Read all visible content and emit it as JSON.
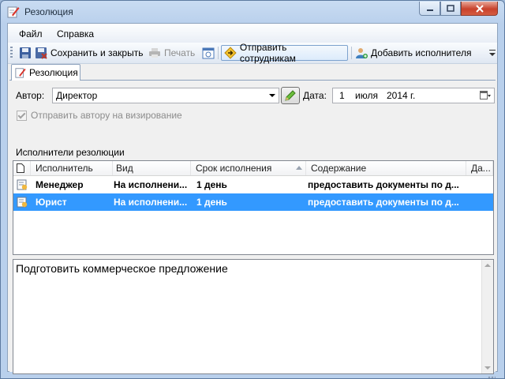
{
  "window": {
    "title": "Резолюция"
  },
  "menu": {
    "items": [
      "Файл",
      "Справка"
    ]
  },
  "toolbar": {
    "save_close": "Сохранить и закрыть",
    "print": "Печать",
    "send_staff": "Отправить сотрудникам",
    "add_executor": "Добавить исполнителя"
  },
  "tab": {
    "label": "Резолюция"
  },
  "form": {
    "author_label": "Автор:",
    "author_value": "Директор",
    "date_label": "Дата:",
    "date_day": "1",
    "date_month": "июля",
    "date_year": "2014 г.",
    "send_author_check": "Отправить автору на визирование",
    "executors_caption": "Исполнители резолюции"
  },
  "grid": {
    "columns": [
      "Исполнитель",
      "Вид",
      "Срок исполнения",
      "Содержание",
      "Да..."
    ],
    "rows": [
      {
        "executor": "Менеджер",
        "kind": "На исполнени...",
        "term": "1 день",
        "content": "предоставить документы по д...",
        "selected": false
      },
      {
        "executor": "Юрист",
        "kind": "На исполнени...",
        "term": "1 день",
        "content": "предоставить документы по д...",
        "selected": true
      }
    ]
  },
  "memo": {
    "text": "Подготовить коммерческое предложение"
  },
  "colors": {
    "selection": "#3399ff",
    "window_frame": "#b9d0ec"
  }
}
